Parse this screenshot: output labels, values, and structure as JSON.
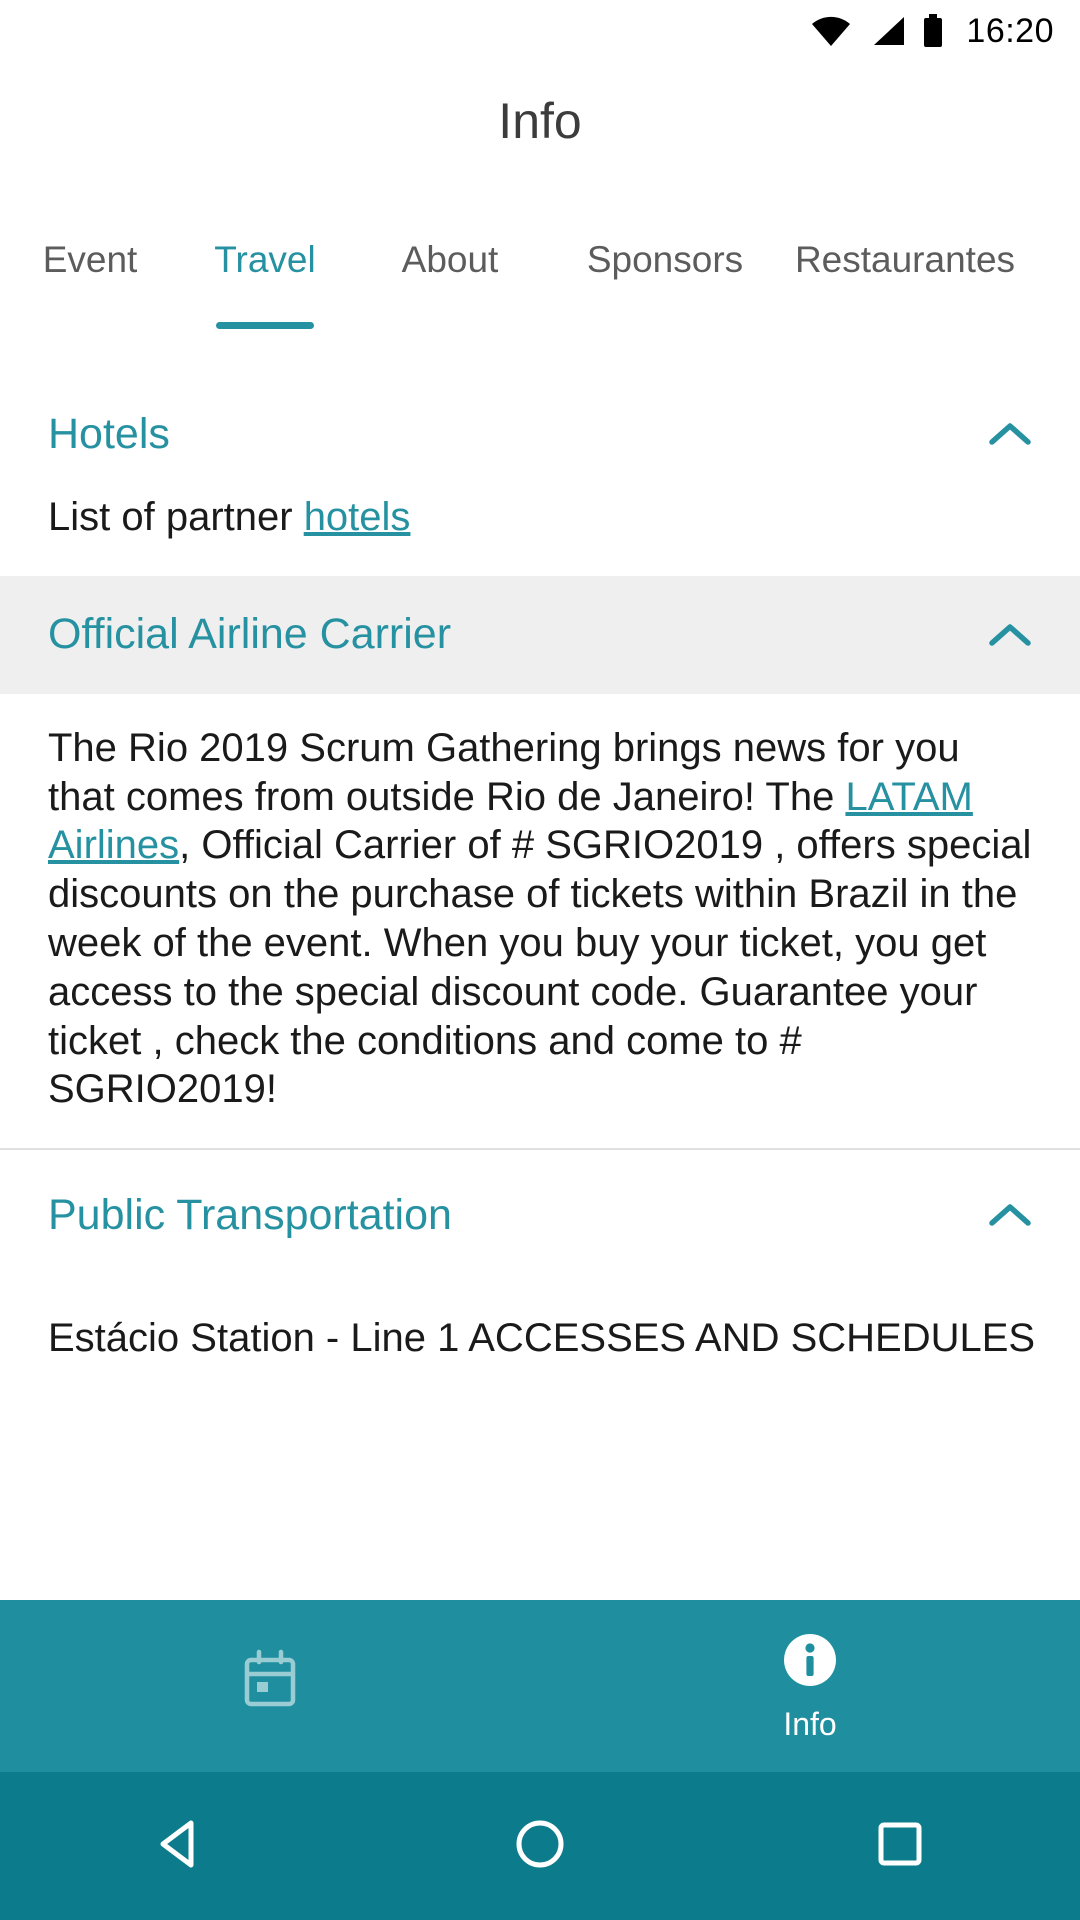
{
  "status_bar": {
    "time": "16:20",
    "icons": [
      "wifi-icon",
      "cellular-signal-icon",
      "battery-icon"
    ]
  },
  "header": {
    "title": "Info"
  },
  "tabs": [
    {
      "label": "Event",
      "active": false
    },
    {
      "label": "Travel",
      "active": true
    },
    {
      "label": "About",
      "active": false
    },
    {
      "label": "Sponsors",
      "active": false
    },
    {
      "label": "Restaurantes",
      "active": false
    }
  ],
  "sections": [
    {
      "title": "Hotels",
      "expanded": true,
      "chevron": "chevron-up-icon",
      "body_prefix": "List of partner ",
      "body_link": "hotels"
    },
    {
      "title": "Official Airline Carrier",
      "expanded": true,
      "chevron": "chevron-up-icon",
      "paragraph_1": "The Rio 2019 Scrum Gathering brings news for you that comes from outside Rio de Janeiro! The ",
      "link_1": "LATAM Airlines",
      "paragraph_2": ",  Official Carrier of # SGRIO2019 , offers special discounts on the purchase of tickets within Brazil in the week of the event. When you buy your ticket, you get access to the special discount code. Guarantee your ticket , check the conditions and come to # SGRIO2019!"
    },
    {
      "title": "Public Transportation",
      "expanded": true,
      "chevron": "chevron-up-icon",
      "clipped_text": "Estácio Station - Line 1 ACCESSES AND SCHEDULES"
    }
  ],
  "bottom_nav": [
    {
      "label": "",
      "icon": "calendar-icon",
      "active": false
    },
    {
      "label": "Info",
      "icon": "info-circle-icon",
      "active": true
    }
  ],
  "system_nav": [
    {
      "name": "back-button",
      "icon": "triangle-back-icon"
    },
    {
      "name": "home-button",
      "icon": "circle-home-icon"
    },
    {
      "name": "recents-button",
      "icon": "square-recents-icon"
    }
  ],
  "colors": {
    "accent_teal": "#2591A1",
    "nav_teal": "#1F8FA0",
    "system_nav_teal": "#0C7C8C",
    "shaded_row": "#efefef",
    "body_text": "#1a1a1a",
    "tab_inactive": "#5c5c5c"
  }
}
